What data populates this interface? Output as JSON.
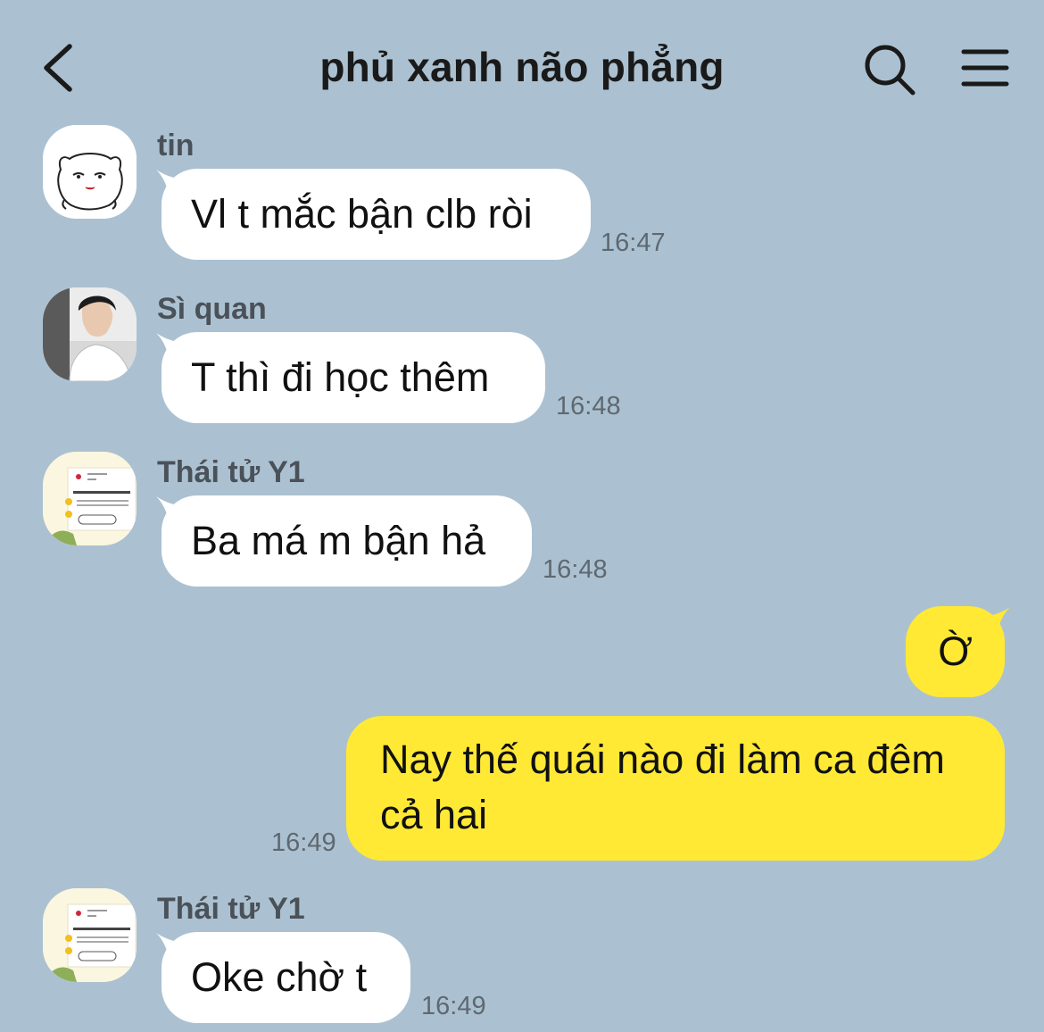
{
  "header": {
    "title": "phủ xanh não phẳng",
    "back_icon": "chevron-left-icon",
    "search_icon": "search-icon",
    "menu_icon": "hamburger-menu-icon"
  },
  "colors": {
    "background": "#abc1d1",
    "incoming_bubble": "#ffffff",
    "outgoing_bubble": "#ffe935",
    "sender_name": "#4a5159",
    "timestamp": "#5f6870"
  },
  "messages": [
    {
      "sender": "tin",
      "text": "Vl t mắc bận clb ròi",
      "time": "16:47",
      "direction": "incoming"
    },
    {
      "sender": "Sì quan",
      "text": "T thì đi học thêm",
      "time": "16:48",
      "direction": "incoming"
    },
    {
      "sender": "Thái tử Y1",
      "text": "Ba má m bận hả",
      "time": "16:48",
      "direction": "incoming"
    },
    {
      "sender": "",
      "text": "Ờ",
      "time": "",
      "direction": "outgoing"
    },
    {
      "sender": "",
      "text_line1": "Nay thế quái nào đi làm ca đêm",
      "text_line2": "cả hai",
      "time": "16:49",
      "direction": "outgoing"
    },
    {
      "sender": "Thái tử Y1",
      "text": "Oke chờ t",
      "time": "16:49",
      "direction": "incoming"
    }
  ]
}
